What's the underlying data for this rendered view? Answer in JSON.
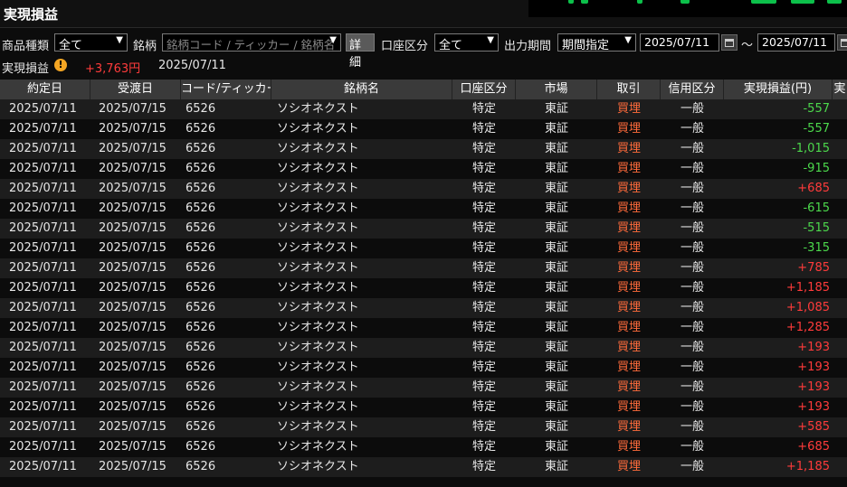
{
  "app": {
    "title": "実現損益"
  },
  "filters": {
    "product_label": "商品種類",
    "product_value": "全て",
    "symbol_label": "銘柄",
    "symbol_placeholder": "銘柄コード / ティッカー / 銘柄名",
    "detail_button": "詳細",
    "account_label": "口座区分",
    "account_value": "全て",
    "period_label": "出力期間",
    "period_value": "期間指定",
    "date_from": "2025/07/11",
    "range_sep": "～",
    "date_to": "2025/07/11"
  },
  "summary": {
    "label": "実現損益",
    "value": "+3,763円",
    "date": "2025/07/11",
    "warning_icon": "warning-icon"
  },
  "colors": {
    "positive": "#ff3b3b",
    "negative": "#4cd94c",
    "buy": "#ff6b3b"
  },
  "table": {
    "headers": [
      "約定日",
      "受渡日",
      "コード/ティッカー",
      "銘柄名",
      "口座区分",
      "市場",
      "取引",
      "信用区分",
      "実現損益(円)",
      "実"
    ],
    "rows": [
      [
        "2025/07/11",
        "2025/07/15",
        "6526",
        "ソシオネクスト",
        "特定",
        "東証",
        "買埋",
        "一般",
        "-557"
      ],
      [
        "2025/07/11",
        "2025/07/15",
        "6526",
        "ソシオネクスト",
        "特定",
        "東証",
        "買埋",
        "一般",
        "-557"
      ],
      [
        "2025/07/11",
        "2025/07/15",
        "6526",
        "ソシオネクスト",
        "特定",
        "東証",
        "買埋",
        "一般",
        "-1,015"
      ],
      [
        "2025/07/11",
        "2025/07/15",
        "6526",
        "ソシオネクスト",
        "特定",
        "東証",
        "買埋",
        "一般",
        "-915"
      ],
      [
        "2025/07/11",
        "2025/07/15",
        "6526",
        "ソシオネクスト",
        "特定",
        "東証",
        "買埋",
        "一般",
        "+685"
      ],
      [
        "2025/07/11",
        "2025/07/15",
        "6526",
        "ソシオネクスト",
        "特定",
        "東証",
        "買埋",
        "一般",
        "-615"
      ],
      [
        "2025/07/11",
        "2025/07/15",
        "6526",
        "ソシオネクスト",
        "特定",
        "東証",
        "買埋",
        "一般",
        "-515"
      ],
      [
        "2025/07/11",
        "2025/07/15",
        "6526",
        "ソシオネクスト",
        "特定",
        "東証",
        "買埋",
        "一般",
        "-315"
      ],
      [
        "2025/07/11",
        "2025/07/15",
        "6526",
        "ソシオネクスト",
        "特定",
        "東証",
        "買埋",
        "一般",
        "+785"
      ],
      [
        "2025/07/11",
        "2025/07/15",
        "6526",
        "ソシオネクスト",
        "特定",
        "東証",
        "買埋",
        "一般",
        "+1,185"
      ],
      [
        "2025/07/11",
        "2025/07/15",
        "6526",
        "ソシオネクスト",
        "特定",
        "東証",
        "買埋",
        "一般",
        "+1,085"
      ],
      [
        "2025/07/11",
        "2025/07/15",
        "6526",
        "ソシオネクスト",
        "特定",
        "東証",
        "買埋",
        "一般",
        "+1,285"
      ],
      [
        "2025/07/11",
        "2025/07/15",
        "6526",
        "ソシオネクスト",
        "特定",
        "東証",
        "買埋",
        "一般",
        "+193"
      ],
      [
        "2025/07/11",
        "2025/07/15",
        "6526",
        "ソシオネクスト",
        "特定",
        "東証",
        "買埋",
        "一般",
        "+193"
      ],
      [
        "2025/07/11",
        "2025/07/15",
        "6526",
        "ソシオネクスト",
        "特定",
        "東証",
        "買埋",
        "一般",
        "+193"
      ],
      [
        "2025/07/11",
        "2025/07/15",
        "6526",
        "ソシオネクスト",
        "特定",
        "東証",
        "買埋",
        "一般",
        "+193"
      ],
      [
        "2025/07/11",
        "2025/07/15",
        "6526",
        "ソシオネクスト",
        "特定",
        "東証",
        "買埋",
        "一般",
        "+585"
      ],
      [
        "2025/07/11",
        "2025/07/15",
        "6526",
        "ソシオネクスト",
        "特定",
        "東証",
        "買埋",
        "一般",
        "+685"
      ],
      [
        "2025/07/11",
        "2025/07/15",
        "6526",
        "ソシオネクスト",
        "特定",
        "東証",
        "買埋",
        "一般",
        "+1,185"
      ]
    ]
  }
}
